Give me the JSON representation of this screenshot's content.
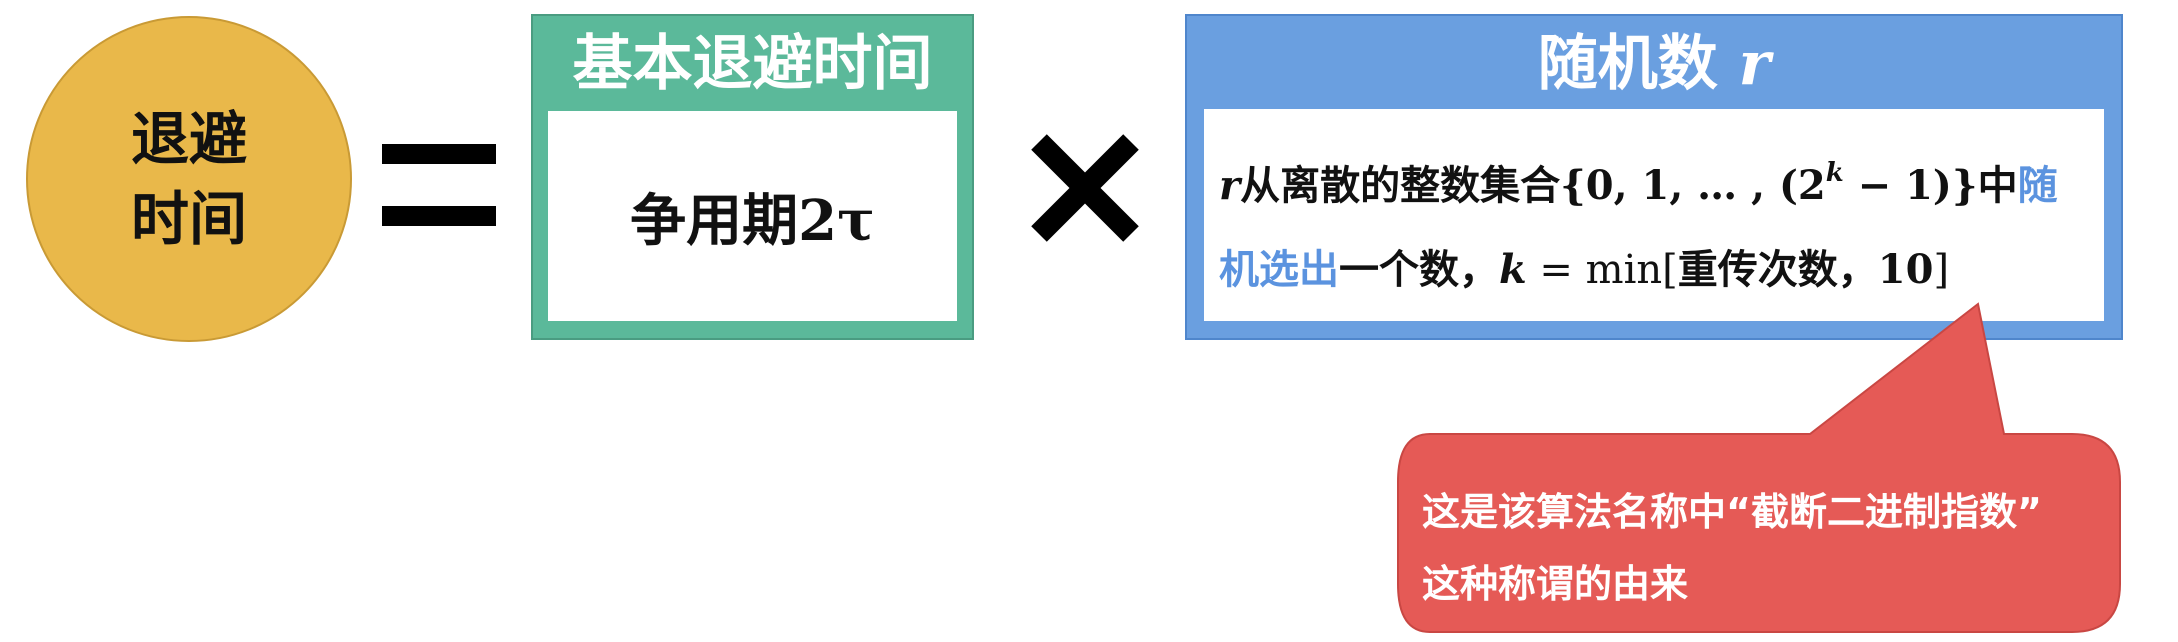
{
  "circle": {
    "line1": "退避",
    "line2": "时间"
  },
  "base_box": {
    "title": "基本退避时间",
    "content_text": "争用期",
    "content_math": "2τ"
  },
  "random_box": {
    "title": "随机数",
    "title_var": "r",
    "line1": {
      "var": "r",
      "text1": "从离散的整数集合",
      "set_open": "{0, 1, … , (2",
      "set_exp": "k",
      "set_close": " − 1)}",
      "text2": "中",
      "highlight1": "随"
    },
    "line2": {
      "highlight2": "机选出",
      "text1": "一个数，",
      "k_var": "k",
      "eq": " = ",
      "min": "min[",
      "text2": "重传次数，",
      "ten": "10",
      "close": "]"
    }
  },
  "callout": {
    "line1": "这是该算法名称中“截断二进制指数”",
    "line2": "这种称谓的由来"
  },
  "colors": {
    "circle_fill": "#e9b84a",
    "green_box": "#5bb99a",
    "blue_box": "#6a9fe0",
    "highlight_text": "#5b93df",
    "callout_fill": "#e55a56"
  }
}
